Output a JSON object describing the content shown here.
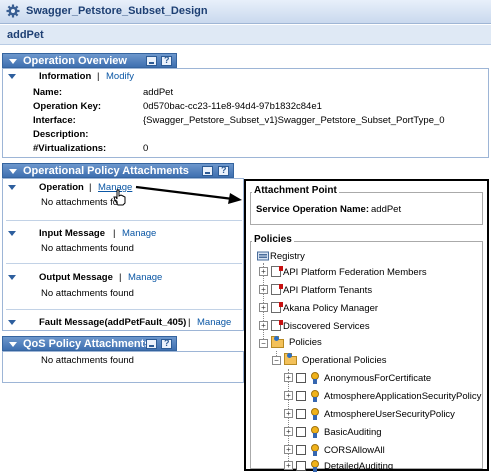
{
  "window": {
    "title": "Swagger_Petstore_Subset_Design"
  },
  "operation": {
    "name": "addPet"
  },
  "overview": {
    "header": "Operation Overview",
    "info_label": "Information",
    "modify_link": "Modify",
    "separator": "|",
    "fields": [
      {
        "label": "Name:",
        "value": "addPet"
      },
      {
        "label": "Operation Key:",
        "value": "0d570bac-cc23-11e8-94d4-97b1832c84e1"
      },
      {
        "label": "Interface:",
        "value": "{Swagger_Petstore_Subset_v1}Swagger_Petstore_Subset_PortType_0"
      },
      {
        "label": "Description:",
        "value": ""
      },
      {
        "label": "#Virtualizations:",
        "value": "0"
      }
    ]
  },
  "policy": {
    "header": "Operational Policy Attachments",
    "rows": [
      {
        "label": "Operation",
        "action": "Manage",
        "status": "No attachments fo"
      },
      {
        "label": "Input Message",
        "action": "Manage",
        "status": "No attachments found"
      },
      {
        "label": "Output Message",
        "action": "Manage",
        "status": "No attachments found"
      },
      {
        "label": "Fault Message(addPetFault_405)",
        "action": "Manage"
      }
    ]
  },
  "qos": {
    "header": "QoS Policy Attachments",
    "status": "No attachments found"
  },
  "popup": {
    "attachment_title": "Attachment Point",
    "service_label": "Service Operation Name:",
    "service_value": "addPet",
    "policies_title": "Policies",
    "tree": {
      "root": "Registry",
      "top_items": [
        "API Platform Federation Members",
        "API Platform Tenants",
        "Akana Policy Manager",
        "Discovered Services",
        "Policies"
      ],
      "sub_folder": "Operational Policies",
      "leaves": [
        "AnonymousForCertificate",
        "AtmosphereApplicationSecurityPolicy",
        "AtmosphereUserSecurityPolicy",
        "BasicAuditing",
        "CORSAllowAll",
        "DetailedAuditing"
      ]
    }
  }
}
